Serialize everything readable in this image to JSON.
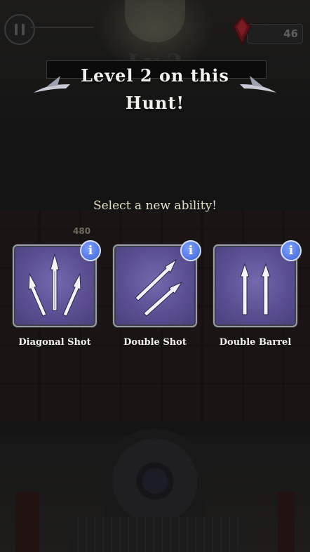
{
  "hud": {
    "gem_count": "46",
    "background_level_text": "Lv 2"
  },
  "level_up": {
    "title": "Level 2 on this Hunt!"
  },
  "ability_select": {
    "prompt": "Select a new ability!",
    "info_glyph": "i",
    "abilities": [
      {
        "label": "Diagonal Shot",
        "icon": "diagonal-shot-icon"
      },
      {
        "label": "Double Shot",
        "icon": "double-shot-icon"
      },
      {
        "label": "Double Barrel",
        "icon": "double-barrel-icon"
      }
    ]
  },
  "background": {
    "enemy_hp": "480"
  },
  "colors": {
    "card_purple": "#5b4f92",
    "info_blue": "#3d61d6",
    "title_text": "#f1f0ec",
    "prompt_text": "#e6dfc6"
  }
}
